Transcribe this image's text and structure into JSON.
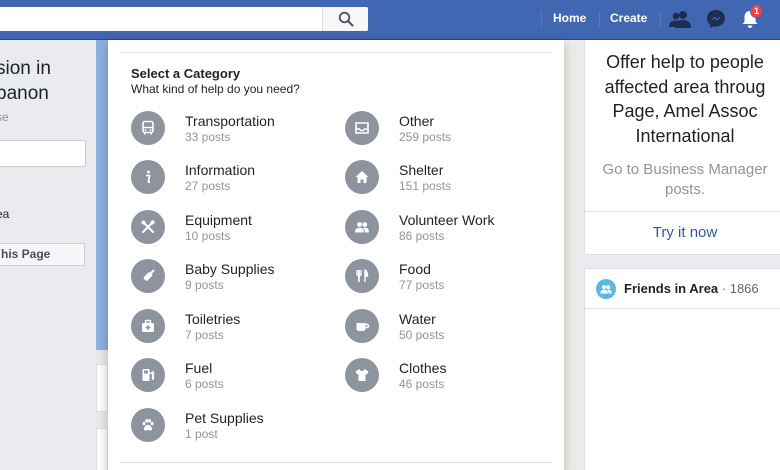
{
  "topbar": {
    "search_placeholder": "",
    "nav": {
      "home": "Home",
      "create": "Create"
    },
    "notification_count": "1"
  },
  "left": {
    "title_lines": [
      "sion in",
      "banon"
    ],
    "subtitle": "se",
    "area_label": "ea",
    "button_label": "his Page"
  },
  "modal": {
    "title": "Select a Category",
    "subtitle": "What kind of help do you need?",
    "categories": [
      {
        "name": "Transportation",
        "posts": "33 posts",
        "icon": "bus-icon"
      },
      {
        "name": "Other",
        "posts": "259 posts",
        "icon": "inbox-icon"
      },
      {
        "name": "Information",
        "posts": "27 posts",
        "icon": "info-icon"
      },
      {
        "name": "Shelter",
        "posts": "151 posts",
        "icon": "house-icon"
      },
      {
        "name": "Equipment",
        "posts": "10 posts",
        "icon": "tools-icon"
      },
      {
        "name": "Volunteer Work",
        "posts": "86 posts",
        "icon": "people-icon"
      },
      {
        "name": "Baby Supplies",
        "posts": "9 posts",
        "icon": "baby-bottle-icon"
      },
      {
        "name": "Food",
        "posts": "77 posts",
        "icon": "fork-knife-icon"
      },
      {
        "name": "Toiletries",
        "posts": "7 posts",
        "icon": "kit-icon"
      },
      {
        "name": "Water",
        "posts": "50 posts",
        "icon": "cup-icon"
      },
      {
        "name": "Fuel",
        "posts": "6 posts",
        "icon": "fuel-pump-icon"
      },
      {
        "name": "Clothes",
        "posts": "46 posts",
        "icon": "shirt-icon"
      },
      {
        "name": "Pet Supplies",
        "posts": "1 post",
        "icon": "paw-icon"
      }
    ]
  },
  "right": {
    "offer_lines": [
      "Offer help to people",
      "affected area throug",
      "Page, Amel Assoc",
      "International"
    ],
    "sub_lines": [
      "Go to Business Manager",
      "posts."
    ],
    "try_link": "Try it now",
    "friends_label": "Friends in Area",
    "friends_count": " · 1866"
  },
  "colors": {
    "topbar": "#4267b2",
    "icon_circle": "#8d949e",
    "link": "#385898",
    "badge": "#fa3e3e",
    "friends_icon": "#5bb7e5"
  }
}
